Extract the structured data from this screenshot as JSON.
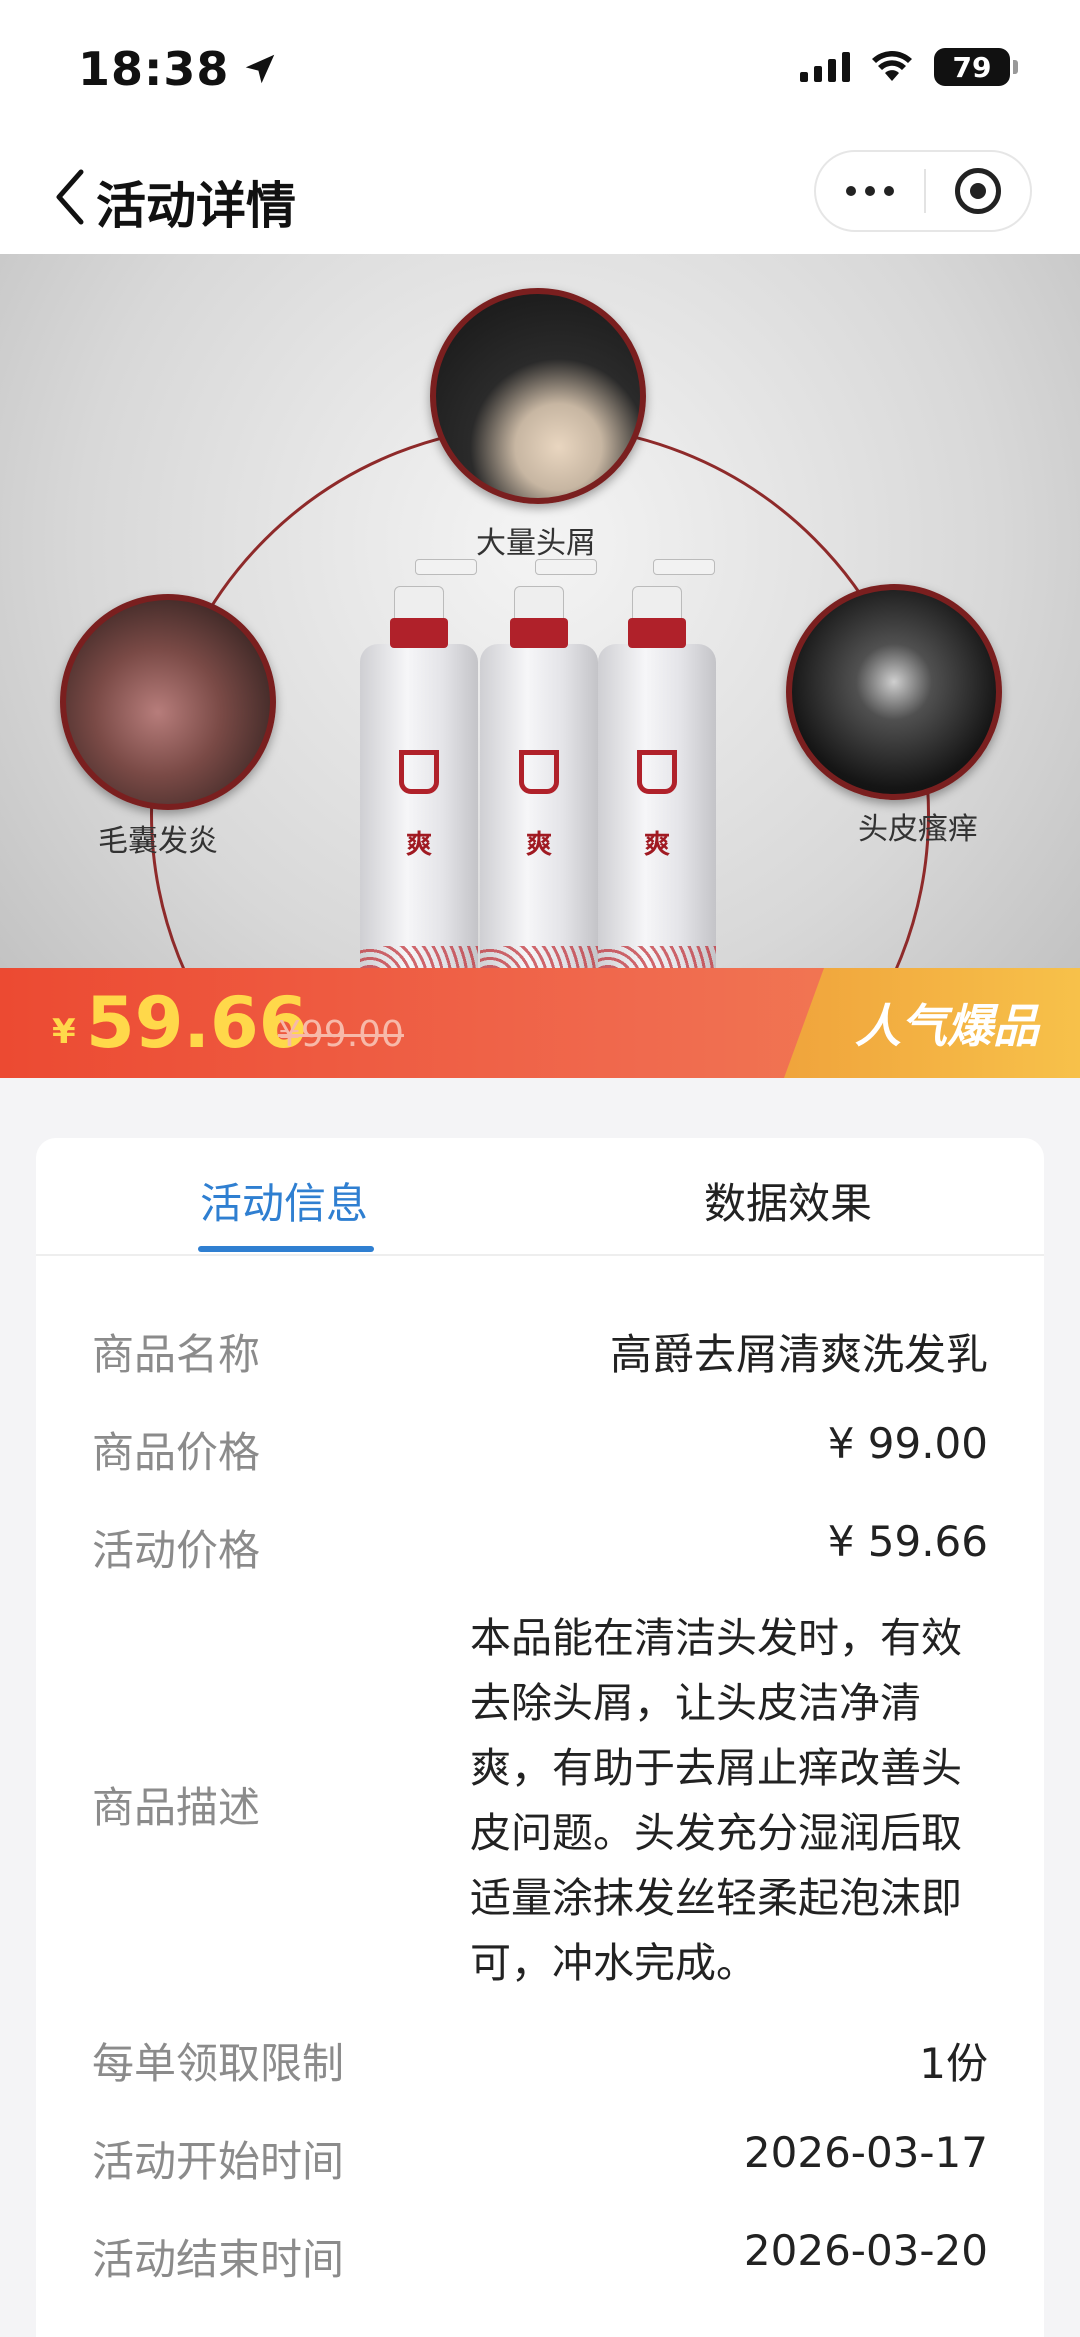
{
  "status_bar": {
    "time": "18:38",
    "battery": "79"
  },
  "nav": {
    "title": "活动详情"
  },
  "banner": {
    "labels": {
      "top": "大量头屑",
      "left": "毛囊发炎",
      "right": "头皮瘙痒"
    },
    "bottle_char": "爽",
    "price_symbol": "¥",
    "price_now": "59.66",
    "price_old": "¥99.00",
    "hot_tag": "人气爆品"
  },
  "tabs": [
    {
      "label": "活动信息",
      "active": true
    },
    {
      "label": "数据效果",
      "active": false
    }
  ],
  "details": {
    "name": {
      "label": "商品名称",
      "value": "高爵去屑清爽洗发乳"
    },
    "price": {
      "label": "商品价格",
      "value": "¥ 99.00"
    },
    "activity_price": {
      "label": "活动价格",
      "value": "¥ 59.66"
    },
    "description": {
      "label": "商品描述",
      "value": "本品能在清洁头发时，有效去除头屑，让头皮洁净清爽，有助于去屑止痒改善头皮问题。头发充分湿润后取适量涂抹发丝轻柔起泡沫即可，冲水完成。"
    },
    "limit": {
      "label": "每单领取限制",
      "value": "1份"
    },
    "start_time": {
      "label": "活动开始时间",
      "value": "2026-03-17"
    },
    "end_time": {
      "label": "活动结束时间",
      "value": "2026-03-20"
    }
  },
  "colors": {
    "accent_blue": "#2f7fd1",
    "price_yellow": "#ffd84a",
    "strip_red": "#ec4a32",
    "tag_orange": "#f0a43c"
  }
}
